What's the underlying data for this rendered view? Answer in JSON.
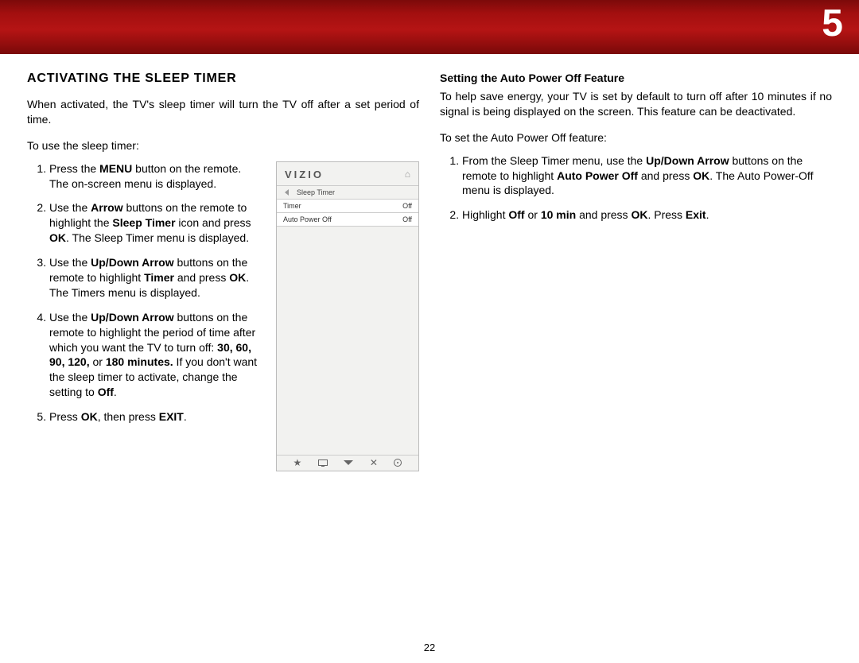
{
  "chapterNumber": "5",
  "pageNumber": "22",
  "left": {
    "title": "ACTIVATING THE SLEEP TIMER",
    "intro": "When activated, the TV's sleep timer will turn the TV off after a set period of time.",
    "lead": "To use the sleep timer:",
    "step1_a": "Press the ",
    "step1_b": "MENU",
    "step1_c": " button on the remote. The on-screen menu is displayed.",
    "step2_a": "Use the ",
    "step2_b": "Arrow",
    "step2_c": " buttons on the remote to highlight the ",
    "step2_d": "Sleep Timer",
    "step2_e": " icon and press ",
    "step2_f": "OK",
    "step2_g": ". The Sleep Timer menu is displayed.",
    "step3_a": "Use the ",
    "step3_b": "Up/Down Arrow",
    "step3_c": " buttons on the remote to highlight ",
    "step3_d": "Timer",
    "step3_e": " and press ",
    "step3_f": "OK",
    "step3_g": ". The Timers menu is displayed.",
    "step4_a": "Use the ",
    "step4_b": "Up/Down Arrow",
    "step4_c": " buttons on the remote to highlight the period of time after which you want the TV to turn off: ",
    "step4_d": "30, 60, 90, 120,",
    "step4_e": " or ",
    "step4_f": "180 minutes.",
    "step4_g": " If you don't want the sleep timer to activate, change the setting to ",
    "step4_h": "Off",
    "step4_i": ".",
    "step5_a": "Press ",
    "step5_b": "OK",
    "step5_c": ", then press ",
    "step5_d": "EXIT",
    "step5_e": "."
  },
  "right": {
    "subheading": "Setting the Auto Power Off Feature",
    "intro": "To help save energy, your TV is set by default to turn off after 10 minutes if no signal is being displayed on the screen. This feature can be deactivated.",
    "lead": "To set the Auto Power Off feature:",
    "step1_a": "From the Sleep Timer menu, use the ",
    "step1_b": "Up/Down Arrow",
    "step1_c": " buttons on the remote to highlight ",
    "step1_d": "Auto Power Off",
    "step1_e": " and press ",
    "step1_f": "OK",
    "step1_g": ". The Auto Power-Off menu is displayed.",
    "step2_a": "Highlight ",
    "step2_b": "Off",
    "step2_c": " or ",
    "step2_d": "10 min",
    "step2_e": " and press ",
    "step2_f": "OK",
    "step2_g": ". Press ",
    "step2_h": "Exit",
    "step2_i": "."
  },
  "screenshot": {
    "logo": "VIZIO",
    "breadcrumb": "Sleep Timer",
    "row1_label": "Timer",
    "row1_value": "Off",
    "row2_label": "Auto Power Off",
    "row2_value": "Off"
  }
}
